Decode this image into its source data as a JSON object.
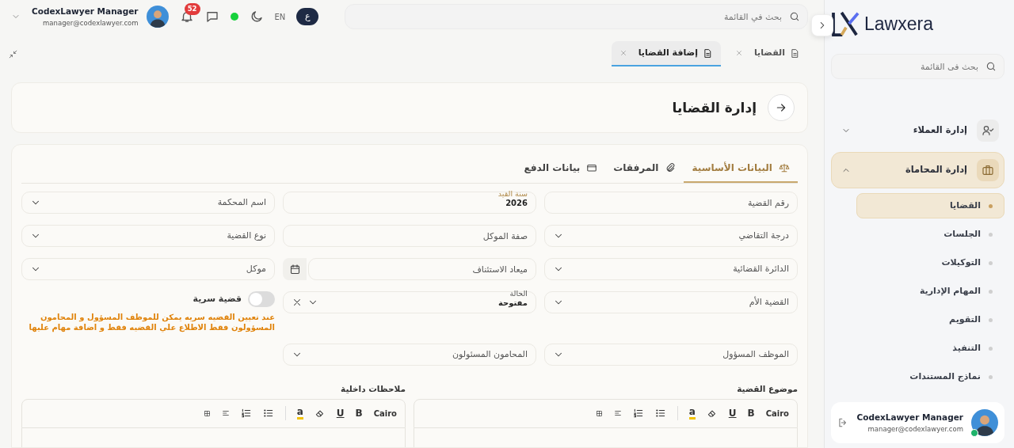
{
  "sidebar": {
    "logo": "Lawxera",
    "search": {
      "placeholder": "بحث فى القائمة"
    },
    "items": [
      {
        "label": "إدارة العملاء",
        "expanded": false,
        "selected": false
      },
      {
        "label": "إدارة المحاماة",
        "expanded": true,
        "selected": true,
        "children": [
          {
            "label": "القضايا",
            "selected": true
          },
          {
            "label": "الجلسات",
            "selected": false
          },
          {
            "label": "التوكيلات",
            "selected": false
          },
          {
            "label": "المهام الإدارية",
            "selected": false
          },
          {
            "label": "التقويم",
            "selected": false
          },
          {
            "label": "التنفيذ",
            "selected": false
          },
          {
            "label": "نماذج المستندات",
            "selected": false
          }
        ]
      }
    ],
    "user": {
      "name": "CodexLawyer Manager",
      "email": "manager@codexlawyer.com",
      "online": true
    }
  },
  "topbar": {
    "search": {
      "placeholder": "بحث في القائمة"
    },
    "languages": [
      {
        "label": "ع",
        "selected": true
      },
      {
        "label": "EN",
        "selected": false
      }
    ],
    "online": true,
    "notifications": "52",
    "user": {
      "name": "CodexLawyer Manager",
      "email": "manager@codexlawyer.com"
    }
  },
  "open_tabs": [
    {
      "label": "القضايا",
      "selected": false
    },
    {
      "label": "إضافة القضايا",
      "selected": true
    }
  ],
  "page_title": "إدارة القضايا",
  "form_tabs": [
    {
      "label": "البيانات الأساسية",
      "selected": true
    },
    {
      "label": "المرفقات",
      "selected": false
    },
    {
      "label": "بيانات الدفع",
      "selected": false
    }
  ],
  "fields": [
    {
      "kind": "input",
      "placeholder": "رقم القضية"
    },
    {
      "kind": "input",
      "label": "سنة القيد",
      "value": "2026",
      "focused": true
    },
    {
      "kind": "select",
      "placeholder": "اسم المحكمة"
    },
    {
      "kind": "select",
      "placeholder": "درجة التقاضي"
    },
    {
      "kind": "input",
      "placeholder": "صفة الموكل"
    },
    {
      "kind": "select",
      "placeholder": "نوع القضية"
    },
    {
      "kind": "select",
      "placeholder": "الدائرة القضائية"
    },
    {
      "kind": "date",
      "placeholder": "ميعاد الاستئناف"
    },
    {
      "kind": "select",
      "placeholder": "موكل"
    },
    {
      "kind": "select",
      "placeholder": "القضية الأم"
    },
    {
      "kind": "select",
      "label": "الحالة",
      "value": "مفتوحة",
      "focused": false,
      "clearable": true
    },
    {
      "kind": "toggle",
      "label": "قضية سرية",
      "on": false,
      "note": "عند تعيين القضيه سريه يمكن للموظف المسؤول و المحامون المسؤولون فقط الاطلاع علي القضيه فقط و اضافة مهام عليها"
    },
    {
      "kind": "select",
      "placeholder": "الموظف المسؤول"
    },
    {
      "kind": "select",
      "placeholder": "المحامون المسئولون"
    }
  ],
  "editors": [
    {
      "label": "موضوع القضية",
      "font": "Cairo",
      "bold": "B",
      "underline": "U",
      "highlight": "a"
    },
    {
      "label": "ملاحظات داخلية",
      "font": "Cairo",
      "bold": "B",
      "underline": "U",
      "highlight": "a"
    }
  ]
}
